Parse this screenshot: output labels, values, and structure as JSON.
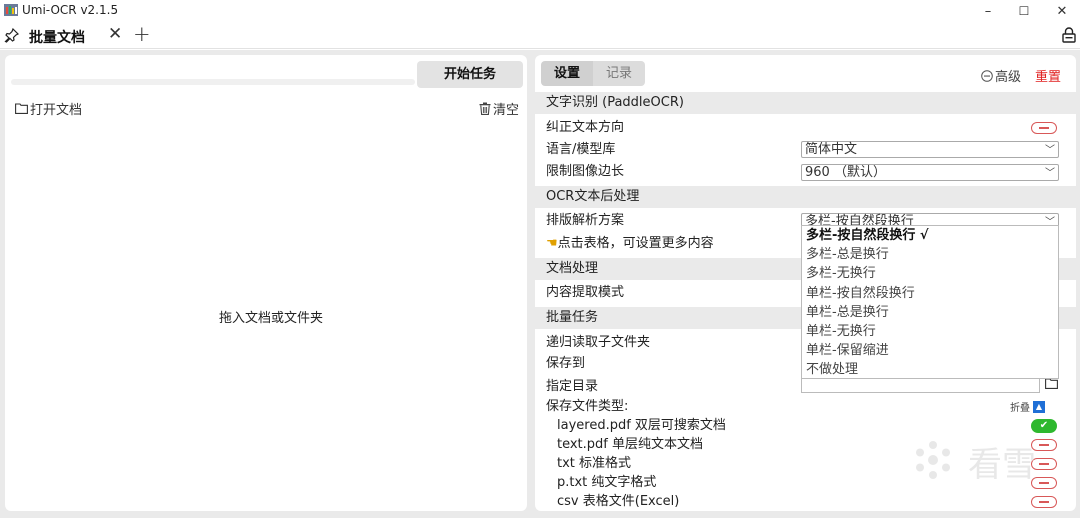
{
  "window": {
    "title": "Umi-OCR v2.1.5",
    "minimize": "–",
    "maximize": "☐",
    "close": "✕"
  },
  "tabbar": {
    "tab_label": "批量文档",
    "tab_close": "✕",
    "add_tab": "+"
  },
  "left_panel": {
    "start_button": "开始任务",
    "open_doc": "打开文档",
    "clear": "清空",
    "drop_hint": "拖入文档或文件夹",
    "progress": 0
  },
  "right_panel": {
    "tabs": [
      "设置",
      "记录"
    ],
    "advanced": "高级",
    "reset": "重置",
    "sections": {
      "ocr": "文字识别 (PaddleOCR)",
      "postprocess": "OCR文本后处理",
      "doc": "文档处理",
      "batch": "批量任务"
    },
    "rows": {
      "correct_direction": "纠正文本方向",
      "language": "语言/模型库",
      "language_value": "简体中文",
      "limit_side": "限制图像边长",
      "limit_side_value": "960 （默认）",
      "layout_scheme": "排版解析方案",
      "layout_value": "多栏-按自然段换行",
      "table_hint": "点击表格，可设置更多内容",
      "content_mode": "内容提取模式",
      "recursive": "递归读取子文件夹",
      "save_to": "保存到",
      "specify_dir": "指定目录",
      "save_types": "保存文件类型:",
      "fold": "折叠"
    },
    "dropdown_options": [
      "多栏-按自然段换行 √",
      "多栏-总是换行",
      "多栏-无换行",
      "单栏-按自然段换行",
      "单栏-总是换行",
      "单栏-无换行",
      "单栏-保留缩进",
      "不做处理"
    ],
    "file_types": [
      {
        "label": "layered.pdf 双层可搜索文档",
        "enabled": true
      },
      {
        "label": "text.pdf 单层纯文本文档",
        "enabled": false
      },
      {
        "label": "txt 标准格式",
        "enabled": false
      },
      {
        "label": "p.txt 纯文字格式",
        "enabled": false
      },
      {
        "label": "csv 表格文件(Excel)",
        "enabled": false
      }
    ]
  },
  "watermark": {
    "text": "看雪"
  }
}
